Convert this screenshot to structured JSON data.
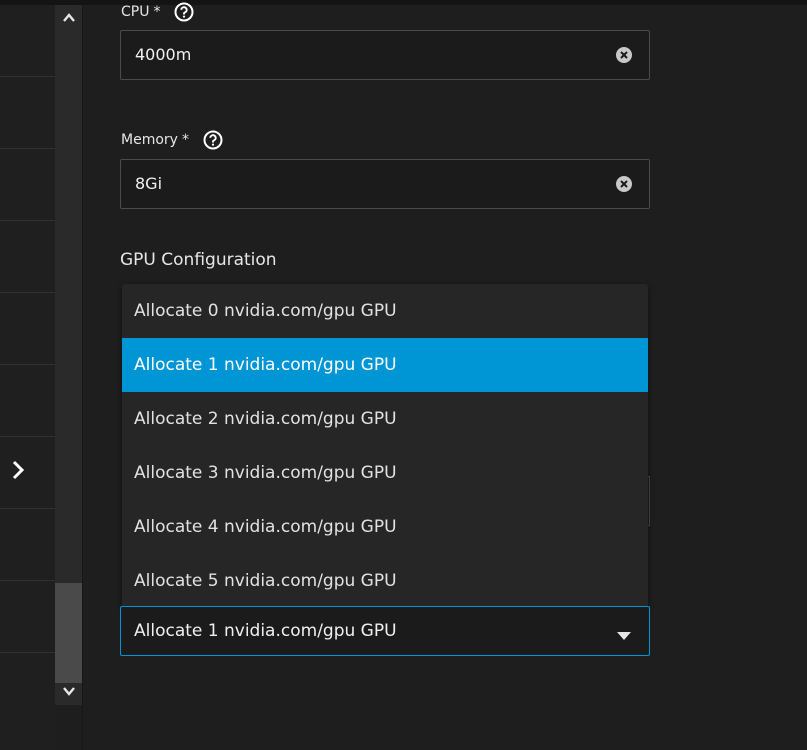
{
  "fields": {
    "cpu": {
      "label": "CPU",
      "required_mark": "*",
      "value": "4000m"
    },
    "memory": {
      "label": "Memory",
      "required_mark": "*",
      "value": "8Gi"
    }
  },
  "gpu": {
    "section_title": "GPU Configuration",
    "options": [
      "Allocate 0 nvidia.com/gpu GPU",
      "Allocate 1 nvidia.com/gpu GPU",
      "Allocate 2 nvidia.com/gpu GPU",
      "Allocate 3 nvidia.com/gpu GPU",
      "Allocate 4 nvidia.com/gpu GPU",
      "Allocate 5 nvidia.com/gpu GPU"
    ],
    "selected_index": 1,
    "selected_value": "Allocate 1 nvidia.com/gpu GPU"
  },
  "icons": {
    "help": "help-circle-icon",
    "clear": "clear-circle-icon",
    "caret": "caret-down-icon",
    "scroll_up": "chevron-up-icon",
    "scroll_down": "chevron-down-icon",
    "expand": "chevron-right-icon"
  },
  "colors": {
    "accent": "#0095d5",
    "background": "#1e1e1e"
  }
}
